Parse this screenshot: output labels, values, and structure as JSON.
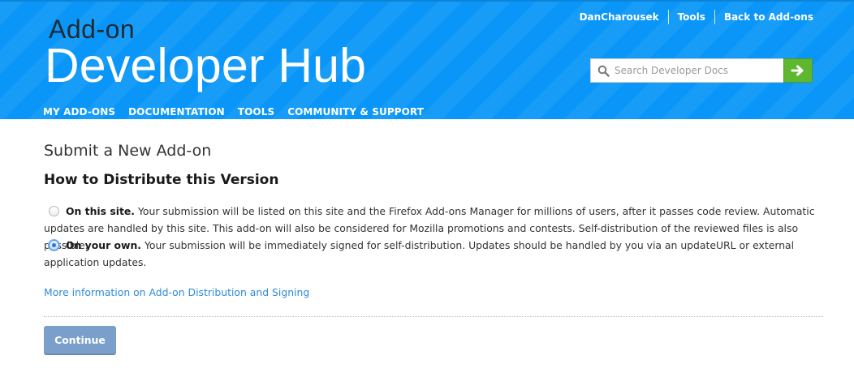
{
  "header": {
    "logo_small": "Add-on",
    "logo_big": "Developer Hub",
    "top_links": [
      "DanCharousek",
      "Tools",
      "Back to Add-ons"
    ],
    "search": {
      "placeholder": "Search Developer Docs",
      "value": ""
    },
    "nav": [
      "MY ADD-ONS",
      "DOCUMENTATION",
      "TOOLS",
      "COMMUNITY & SUPPORT"
    ]
  },
  "main": {
    "title": "Submit a New Add-on",
    "section_title": "How to Distribute this Version",
    "options": [
      {
        "label": "On this site.",
        "description": "Your submission will be listed on this site and the Firefox Add-ons Manager for millions of users, after it passes code review. Automatic updates are handled by this site. This add-on will also be considered for Mozilla promotions and contests. Self-distribution of the reviewed files is also possible.",
        "selected": false
      },
      {
        "label": "On your own.",
        "description": "Your submission will be immediately signed for self-distribution. Updates should be handled by you via an updateURL or external application updates.",
        "selected": true
      }
    ],
    "more_link": "More information on Add-on Distribution and Signing",
    "continue_label": "Continue"
  },
  "colors": {
    "header_bg": "#0996f8",
    "search_go": "#5fb72f",
    "link": "#2f8bd8",
    "button": "#7a9fca"
  },
  "icons": {
    "search": "search-icon",
    "go": "arrow-right-icon"
  }
}
